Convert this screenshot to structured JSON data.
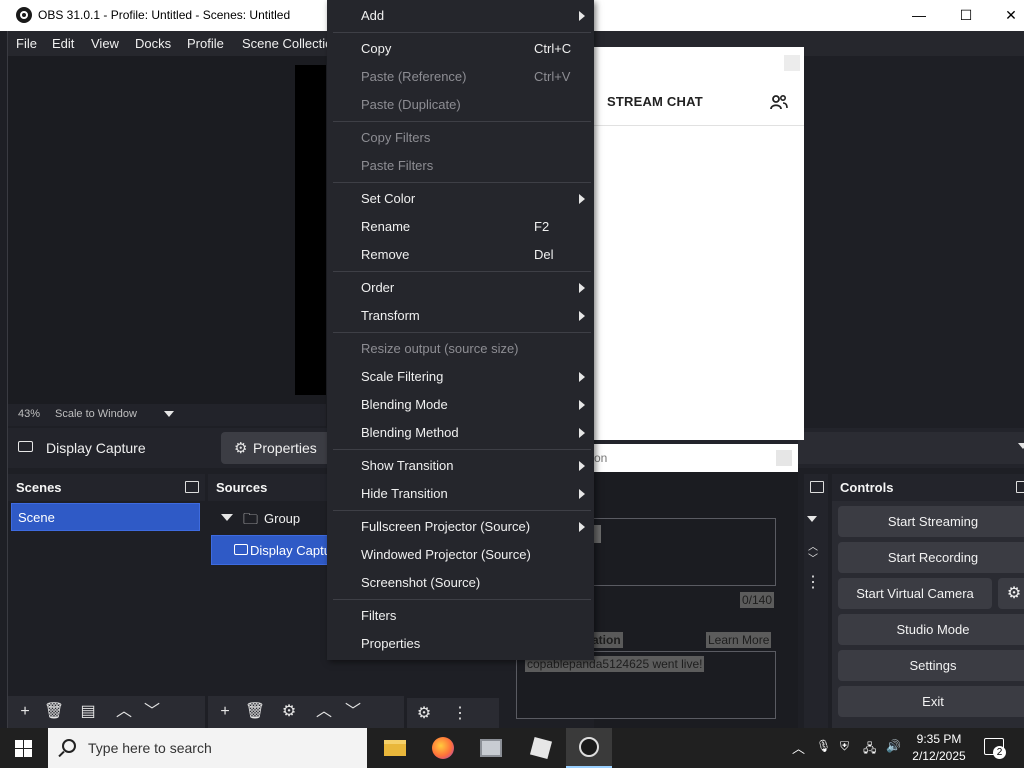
{
  "window": {
    "title": "OBS 31.0.1 - Profile: Untitled - Scenes: Untitled",
    "minimize": "—",
    "maximize": "☐",
    "close": "✕"
  },
  "menubar": [
    "File",
    "Edit",
    "View",
    "Docks",
    "Profile",
    "Scene Collectio"
  ],
  "preview": {
    "zoom": "43%",
    "scale_mode": "Scale to Window"
  },
  "source_toolbar": {
    "source_name": "Display Capture",
    "properties_label": "Properties"
  },
  "scenes": {
    "title": "Scenes",
    "items": [
      "Scene"
    ]
  },
  "sources": {
    "title": "Sources",
    "group": "Group",
    "item": "Display Captu"
  },
  "controls": {
    "title": "Controls",
    "buttons": [
      "Start Streaming",
      "Start Recording",
      "Start Virtual Camera",
      "Studio Mode",
      "Settings",
      "Exit"
    ]
  },
  "chat": {
    "title": "STREAM CHAT"
  },
  "notif": {
    "title_fragment": "on",
    "counter": "0/140",
    "notification_label": "fication",
    "learn_more": "Learn More",
    "message": "copablepanda5124625 went live!"
  },
  "context_menu": {
    "items": [
      {
        "label": "Add",
        "submenu": true
      },
      {
        "label": "Copy",
        "shortcut": "Ctrl+C"
      },
      {
        "label": "Paste (Reference)",
        "shortcut": "Ctrl+V",
        "disabled": true
      },
      {
        "label": "Paste (Duplicate)",
        "disabled": true
      },
      {
        "label": "Copy Filters",
        "disabled": true
      },
      {
        "label": "Paste Filters",
        "disabled": true
      },
      {
        "label": "Set Color",
        "submenu": true
      },
      {
        "label": "Rename",
        "shortcut": "F2"
      },
      {
        "label": "Remove",
        "shortcut": "Del"
      },
      {
        "label": "Order",
        "submenu": true
      },
      {
        "label": "Transform",
        "submenu": true
      },
      {
        "label": "Resize output (source size)",
        "disabled": true
      },
      {
        "label": "Scale Filtering",
        "submenu": true
      },
      {
        "label": "Blending Mode",
        "submenu": true
      },
      {
        "label": "Blending Method",
        "submenu": true
      },
      {
        "label": "Show Transition",
        "submenu": true
      },
      {
        "label": "Hide Transition",
        "submenu": true
      },
      {
        "label": "Fullscreen Projector (Source)",
        "submenu": true
      },
      {
        "label": "Windowed Projector (Source)"
      },
      {
        "label": "Screenshot (Source)"
      },
      {
        "label": "Filters"
      },
      {
        "label": "Properties"
      }
    ]
  },
  "taskbar": {
    "search_placeholder": "Type here to search",
    "time": "9:35 PM",
    "date": "2/12/2025",
    "notification_count": "2"
  },
  "colors": {
    "accent": "#2f5ac6",
    "background": "#1e1f25",
    "menu_bg": "#25262c"
  }
}
